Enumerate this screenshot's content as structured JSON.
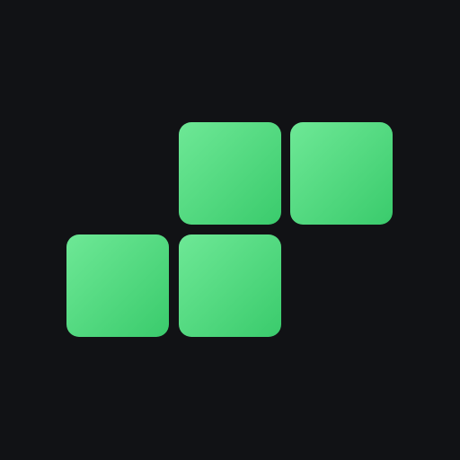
{
  "logo": {
    "colors": {
      "background": "#111215",
      "block_light": "#6ee896",
      "block_dark": "#3acb6c"
    },
    "blocks": [
      {
        "name": "top-middle"
      },
      {
        "name": "top-right"
      },
      {
        "name": "bottom-left"
      },
      {
        "name": "bottom-middle"
      }
    ]
  }
}
